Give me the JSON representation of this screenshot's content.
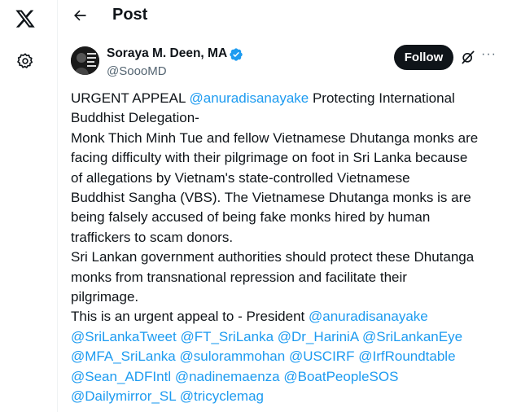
{
  "icons": {
    "logo": "x-logo-icon",
    "settings": "gear-icon",
    "back": "back-arrow-icon",
    "verified": "verified-badge-icon",
    "grok": "grok-icon",
    "more": "more-icon"
  },
  "colors": {
    "text": "#0f1419",
    "link": "#1d9bf0",
    "muted": "#536471",
    "follow_bg": "#0f1419"
  },
  "header": {
    "title": "Post"
  },
  "author": {
    "name": "Soraya M. Deen, MA",
    "handle": "@SoooMD"
  },
  "actions": {
    "follow_label": "Follow",
    "more_label": "···"
  },
  "tweet": {
    "lines": [
      [
        {
          "t": "URGENT APPEAL "
        },
        {
          "t": "@anuradisanayake",
          "m": true
        },
        {
          "t": " Protecting International"
        }
      ],
      [
        {
          "t": "Buddhist Delegation-"
        }
      ],
      [
        {
          "t": "Monk Thich Minh Tue and fellow Vietnamese Dhutanga monks are"
        }
      ],
      [
        {
          "t": "facing difficulty with their pilgrimage on foot in Sri Lanka because"
        }
      ],
      [
        {
          "t": "of  allegations by Vietnam's state-controlled Vietnamese"
        }
      ],
      [
        {
          "t": "Buddhist Sangha (VBS). The Vietnamese Dhutanga monks is are"
        }
      ],
      [
        {
          "t": "being falsely accused of being fake monks hired by human"
        }
      ],
      [
        {
          "t": "traffickers to scam donors."
        }
      ],
      [
        {
          "t": "Sri Lankan government authorities should protect these Dhutanga"
        }
      ],
      [
        {
          "t": "monks from transnational repression and facilitate their"
        }
      ],
      [
        {
          "t": "pilgrimage."
        }
      ],
      [
        {
          "t": "This is an urgent appeal to - President "
        },
        {
          "t": "@anuradisanayake",
          "m": true
        }
      ],
      [
        {
          "t": "@SriLankaTweet",
          "m": true
        },
        {
          "t": " "
        },
        {
          "t": "@FT_SriLanka",
          "m": true
        },
        {
          "t": " "
        },
        {
          "t": "@Dr_HariniA",
          "m": true
        },
        {
          "t": " "
        },
        {
          "t": "@SriLankanEye",
          "m": true
        }
      ],
      [
        {
          "t": "@MFA_SriLanka",
          "m": true
        },
        {
          "t": " "
        },
        {
          "t": "@sulorammohan",
          "m": true
        },
        {
          "t": " "
        },
        {
          "t": "@USCIRF",
          "m": true
        },
        {
          "t": " "
        },
        {
          "t": "@IrfRoundtable",
          "m": true
        }
      ],
      [
        {
          "t": "@Sean_ADFIntl",
          "m": true
        },
        {
          "t": " "
        },
        {
          "t": "@nadinemaenza",
          "m": true
        },
        {
          "t": " "
        },
        {
          "t": "@BoatPeopleSOS",
          "m": true
        }
      ],
      [
        {
          "t": "@Dailymirror_SL",
          "m": true
        },
        {
          "t": " "
        },
        {
          "t": "@tricyclemag",
          "m": true
        }
      ]
    ]
  }
}
